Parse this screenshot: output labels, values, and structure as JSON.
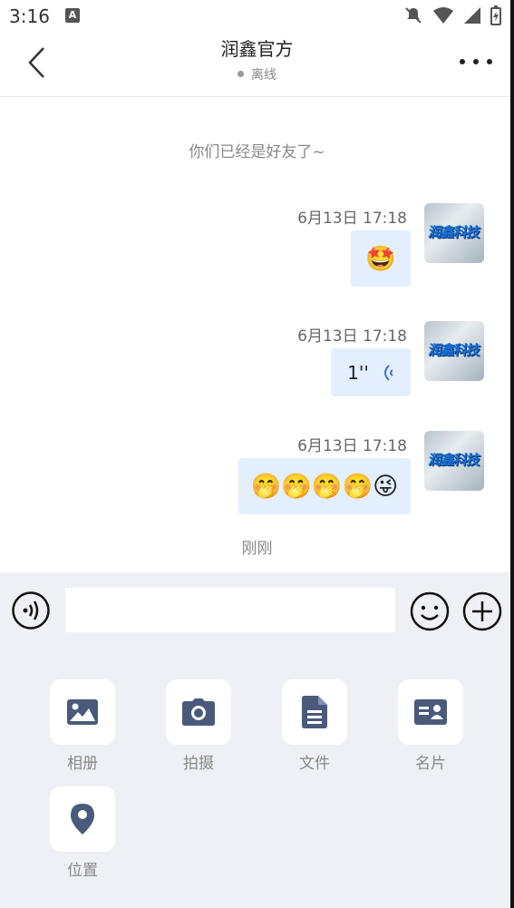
{
  "status_bar": {
    "time": "3:16",
    "a_badge": "A"
  },
  "header": {
    "title": "润鑫官方",
    "status": "离线"
  },
  "chat": {
    "system_message": "你们已经是好友了~",
    "avatar_text": "润鑫科技",
    "messages": [
      {
        "time": "6月13日 17:18",
        "type": "emoji",
        "content": "🤩"
      },
      {
        "time": "6月13日 17:18",
        "type": "voice",
        "content": "1''"
      },
      {
        "time": "6月13日 17:18",
        "type": "emoji",
        "content": "🤭🤭🤭🤭😜"
      }
    ],
    "recent_label": "刚刚"
  },
  "input": {
    "value": "",
    "placeholder": ""
  },
  "tools": [
    {
      "label": "相册",
      "icon": "image-icon"
    },
    {
      "label": "拍摄",
      "icon": "camera-icon"
    },
    {
      "label": "文件",
      "icon": "file-icon"
    },
    {
      "label": "名片",
      "icon": "contact-card-icon"
    },
    {
      "label": "位置",
      "icon": "location-pin-icon"
    }
  ],
  "colors": {
    "bubble": "#e3effd",
    "panel": "#eff0f5",
    "icon": "#4a5a7a",
    "voice_wave": "#3b73c8"
  }
}
